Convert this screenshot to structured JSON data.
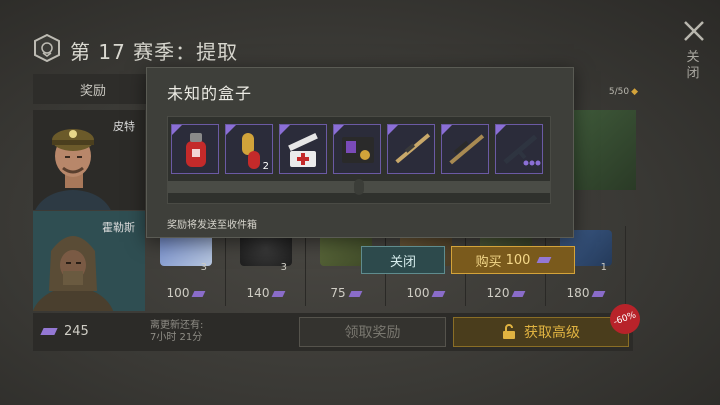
{
  "header": {
    "season_title": "第 17 赛季：提取",
    "close_label": "关闭"
  },
  "tabs": {
    "reward_label": "奖励"
  },
  "progress": {
    "text": "5/50"
  },
  "characters": [
    {
      "name": "皮特"
    },
    {
      "name": "霍勒斯"
    }
  ],
  "rewards": [
    {
      "count": "3",
      "price": "100"
    },
    {
      "count": "3",
      "price": "140"
    },
    {
      "count": "",
      "price": "75"
    },
    {
      "count": "",
      "price": "100"
    },
    {
      "count": "",
      "price": "120"
    },
    {
      "count": "1",
      "price": "180"
    }
  ],
  "footer": {
    "currency_amount": "245",
    "refresh_label_1": "离更新还有:",
    "refresh_label_2": "7小时 21分",
    "claim_label": "领取奖励",
    "premium_label": "获取高级",
    "discount": "-60%"
  },
  "popup": {
    "title": "未知的盒子",
    "items": [
      {
        "icon": "gas-canister-icon",
        "qty": ""
      },
      {
        "icon": "pills-icon",
        "qty": "2"
      },
      {
        "icon": "syringe-kit-icon",
        "qty": ""
      },
      {
        "icon": "id-card-icon",
        "qty": ""
      },
      {
        "icon": "sniper-rifle-icon",
        "qty": ""
      },
      {
        "icon": "scoped-rifle-icon",
        "qty": ""
      },
      {
        "icon": "assault-rifle-icon",
        "qty": ""
      }
    ],
    "note": "奖励将发送至收件箱",
    "close_label": "关闭",
    "buy_label": "购买",
    "buy_price": "100"
  },
  "colors": {
    "rare_border": "#6b5aa4",
    "gem": "#9478d4",
    "gold": "#d4a33a",
    "teal_button": "#2d4a4c"
  }
}
